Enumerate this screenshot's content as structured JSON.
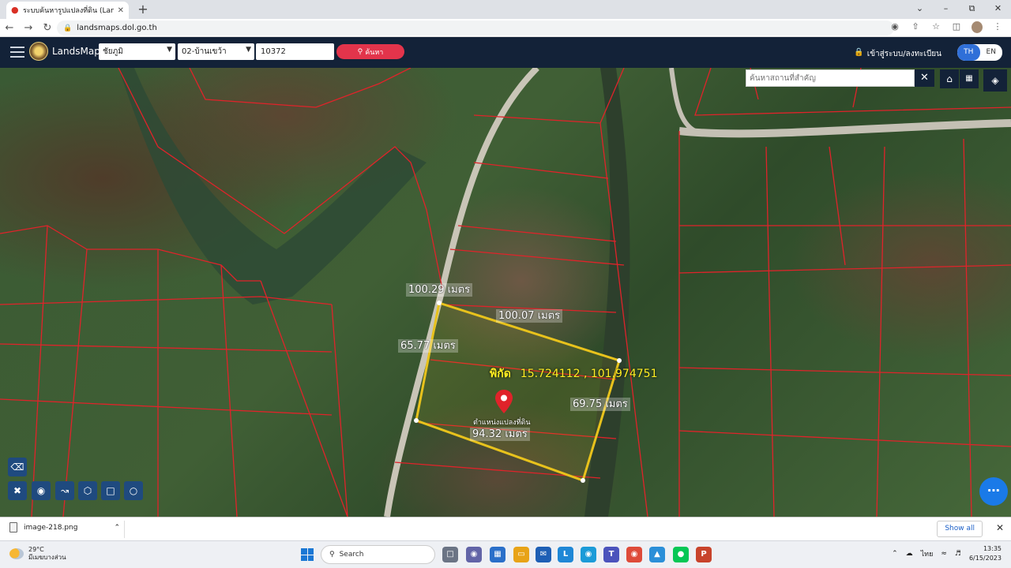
{
  "browser": {
    "tab_title": "ระบบค้นหารูปแปลงที่ดิน (LandsMaps)",
    "new_tab_symbol": "+",
    "url": "landsmaps.dol.go.th"
  },
  "header": {
    "app_name": "LandsMaps",
    "province": "ชัยภูมิ",
    "district": "02-บ้านเขว้า",
    "parcel_number": "10372",
    "search_label": "ค้นหา",
    "login_label": "เข้าสู่ระบบ/ลงทะเบียน",
    "lang_th": "TH",
    "lang_en": "EN"
  },
  "map": {
    "search_placeholder": "ค้นหาสถานที่สำคัญ",
    "coordinate_label": "พิกัด",
    "coordinate_value": "15.724112 , 101.974751",
    "pin_label": "ตำแหน่งแปลงที่ดิน",
    "measurements": {
      "north_west_corner": "100.29 เมตร",
      "top_edge": "100.07 เมตร",
      "left_edge": "65.77 เมตร",
      "right_edge": "69.75 เมตร",
      "bottom_edge": "94.32 เมตร"
    },
    "colors": {
      "parcel_lines": "#e0232a",
      "selected_parcel": "#e8c21c",
      "coordinate_text": "#ffee22"
    }
  },
  "download": {
    "file_name": "image-218.png",
    "show_all_label": "Show all"
  },
  "taskbar": {
    "temperature": "29°C",
    "weather_text": "มีเมฆบางส่วน",
    "search_label": "Search",
    "lang_indicator": "ไทย",
    "time": "13:35",
    "date": "6/15/2023"
  }
}
